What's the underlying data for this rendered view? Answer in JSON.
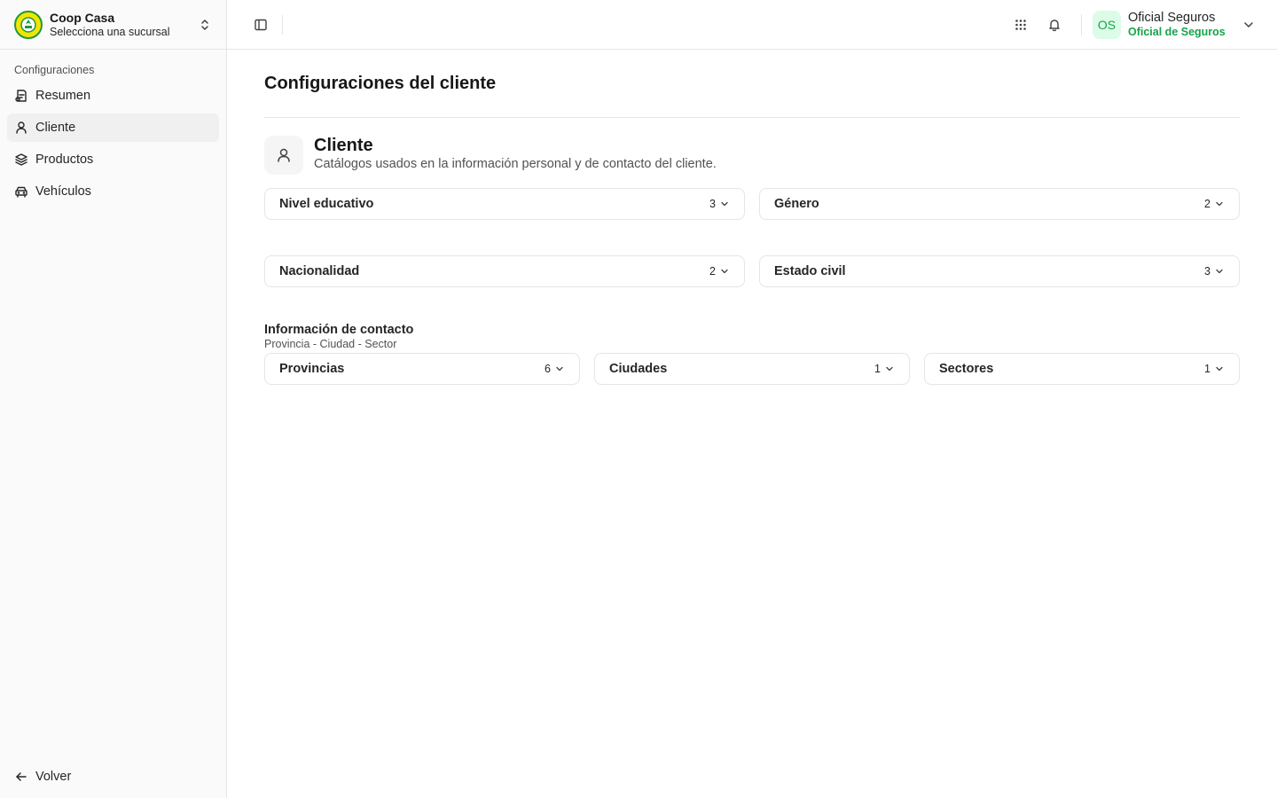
{
  "org": {
    "name": "Coop Casa",
    "branch_placeholder": "Selecciona una sucursal"
  },
  "sidebar": {
    "group_label": "Configuraciones",
    "items": [
      {
        "label": "Resumen",
        "icon": "receipt-icon",
        "active": false
      },
      {
        "label": "Cliente",
        "icon": "user-icon",
        "active": true
      },
      {
        "label": "Productos",
        "icon": "layers-icon",
        "active": false
      },
      {
        "label": "Vehículos",
        "icon": "car-icon",
        "active": false
      }
    ],
    "back_label": "Volver"
  },
  "header": {
    "user": {
      "initials": "OS",
      "name": "Oficial Seguros",
      "role": "Oficial de Seguros"
    }
  },
  "main": {
    "title": "Configuraciones del cliente",
    "section": {
      "title": "Cliente",
      "description": "Catálogos usados en la información personal y de contacto del cliente."
    },
    "catalogs_row1": [
      {
        "label": "Nivel educativo",
        "count": "3"
      },
      {
        "label": "Género",
        "count": "2"
      }
    ],
    "catalogs_row2": [
      {
        "label": "Nacionalidad",
        "count": "2"
      },
      {
        "label": "Estado civil",
        "count": "3"
      }
    ],
    "contact": {
      "title": "Información de contacto",
      "subtitle": "Provincia - Ciudad - Sector",
      "catalogs": [
        {
          "label": "Provincias",
          "count": "6"
        },
        {
          "label": "Ciudades",
          "count": "1"
        },
        {
          "label": "Sectores",
          "count": "1"
        }
      ]
    }
  },
  "colors": {
    "accent_green": "#16a34a",
    "avatar_bg": "#dcfce7",
    "logo_yellow": "#f2e500"
  }
}
